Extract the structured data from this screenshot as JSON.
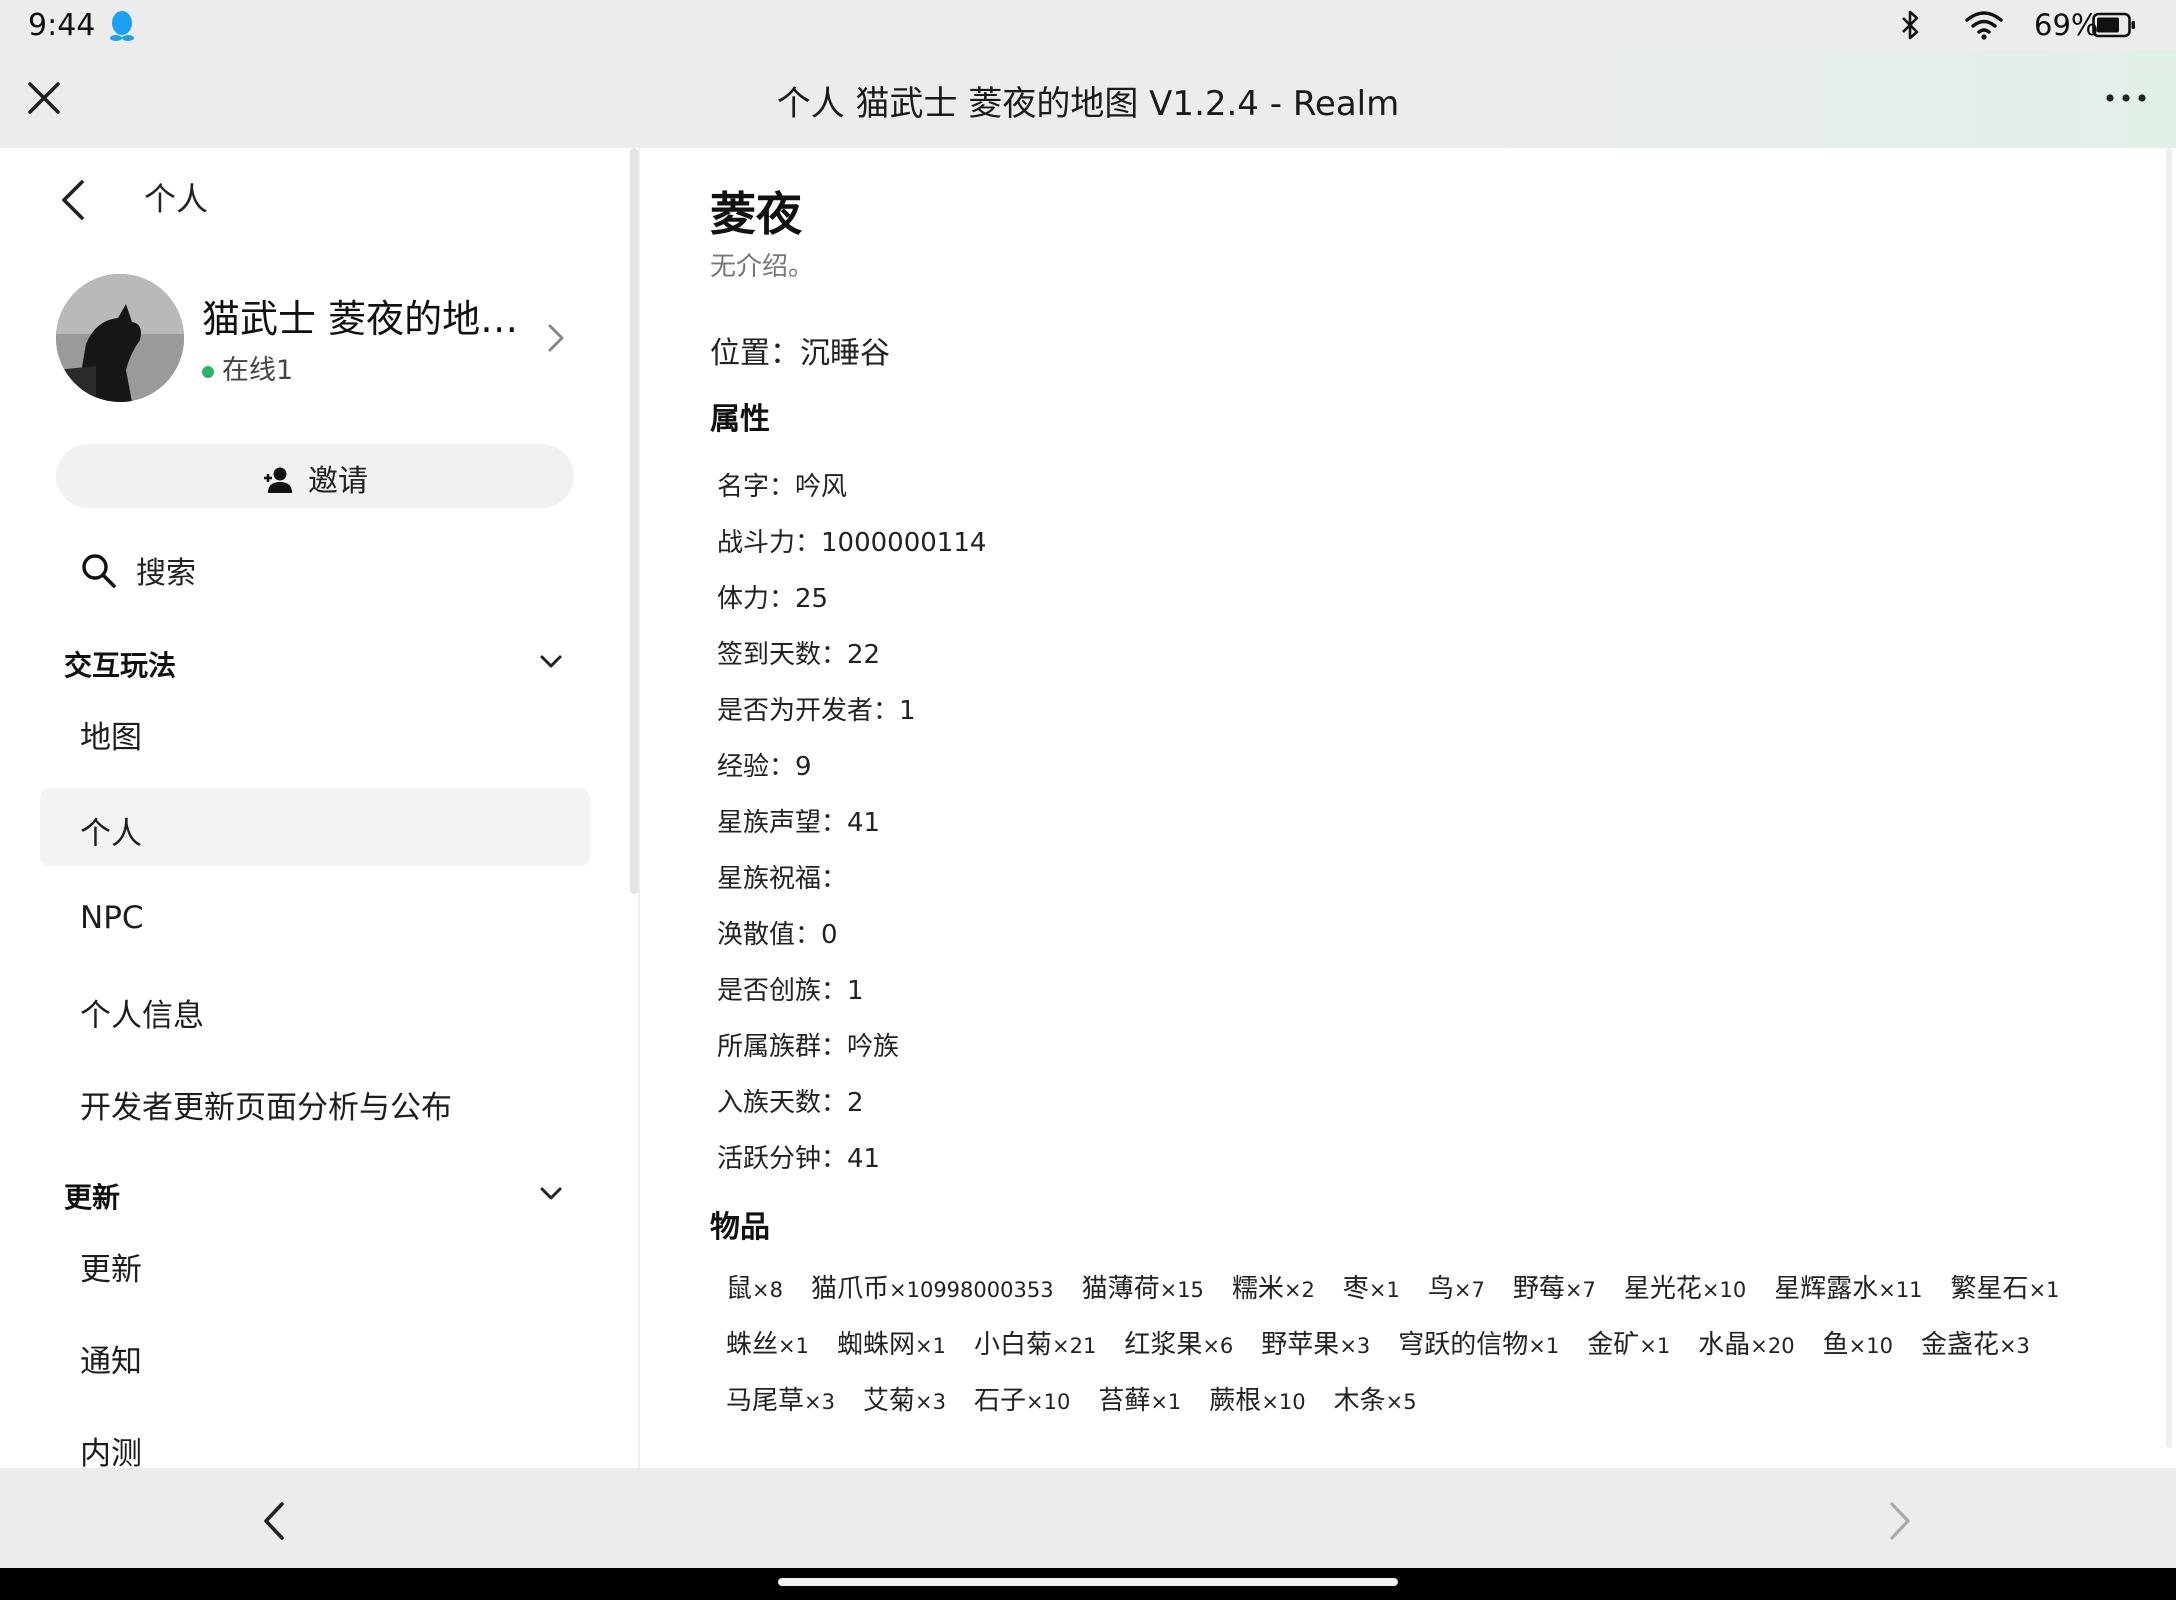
{
  "status_bar": {
    "time": "9:44",
    "battery": "69%",
    "icons": [
      "qq-icon",
      "bluetooth-icon",
      "wifi-icon",
      "battery-icon"
    ]
  },
  "title_bar": {
    "title": "个人 猫武士 菱夜的地图 V1.2.4 - Realm"
  },
  "sidebar": {
    "back_label": "个人",
    "profile": {
      "name": "猫武士 菱夜的地…",
      "online": "在线1"
    },
    "invite_label": "邀请",
    "search_label": "搜索",
    "sections": [
      {
        "title": "交互玩法",
        "items": [
          {
            "label": "地图"
          },
          {
            "label": "个人"
          },
          {
            "label": "NPC"
          },
          {
            "label": "个人信息"
          },
          {
            "label": "开发者更新页面分析与公布"
          }
        ]
      },
      {
        "title": "更新",
        "items": [
          {
            "label": "更新"
          },
          {
            "label": "通知"
          },
          {
            "label": "内测"
          }
        ]
      }
    ]
  },
  "main": {
    "title": "菱夜",
    "subtitle": "无介绍。",
    "location": "位置：沉睡谷",
    "attributes_heading": "属性",
    "attributes": [
      "名字：吟风",
      "战斗力：1000000114",
      "体力：25",
      "签到天数：22",
      "是否为开发者：1",
      "经验：9",
      "星族声望：41",
      "星族祝福：",
      "涣散值：0",
      "是否创族：1",
      "所属族群：吟族",
      "入族天数：2",
      "活跃分钟：41"
    ],
    "items_heading": "物品",
    "items": [
      [
        {
          "name": "鼠",
          "count": "×8"
        },
        {
          "name": "猫爪币",
          "count": "×10998000353"
        },
        {
          "name": "猫薄荷",
          "count": "×15"
        },
        {
          "name": "糯米",
          "count": "×2"
        },
        {
          "name": "枣",
          "count": "×1"
        },
        {
          "name": "鸟",
          "count": "×7"
        },
        {
          "name": "野莓",
          "count": "×7"
        },
        {
          "name": "星光花",
          "count": "×10"
        },
        {
          "name": "星辉露水",
          "count": "×11"
        },
        {
          "name": "繁星石",
          "count": "×1"
        }
      ],
      [
        {
          "name": "蛛丝",
          "count": "×1"
        },
        {
          "name": "蜘蛛网",
          "count": "×1"
        },
        {
          "name": "小白菊",
          "count": "×21"
        },
        {
          "name": "红浆果",
          "count": "×6"
        },
        {
          "name": "野苹果",
          "count": "×3"
        },
        {
          "name": "穹跃的信物",
          "count": "×1"
        },
        {
          "name": "金矿",
          "count": "×1"
        },
        {
          "name": "水晶",
          "count": "×20"
        },
        {
          "name": "鱼",
          "count": "×10"
        },
        {
          "name": "金盏花",
          "count": "×3"
        }
      ],
      [
        {
          "name": "马尾草",
          "count": "×3"
        },
        {
          "name": "艾菊",
          "count": "×3"
        },
        {
          "name": "石子",
          "count": "×10"
        },
        {
          "name": "苔藓",
          "count": "×1"
        },
        {
          "name": "蕨根",
          "count": "×10"
        },
        {
          "name": "木条",
          "count": "×5"
        }
      ]
    ]
  },
  "colors": {
    "online_dot": "#2fb360",
    "active_bg": "#f2f3f5",
    "bar_bg": "#ececec"
  }
}
